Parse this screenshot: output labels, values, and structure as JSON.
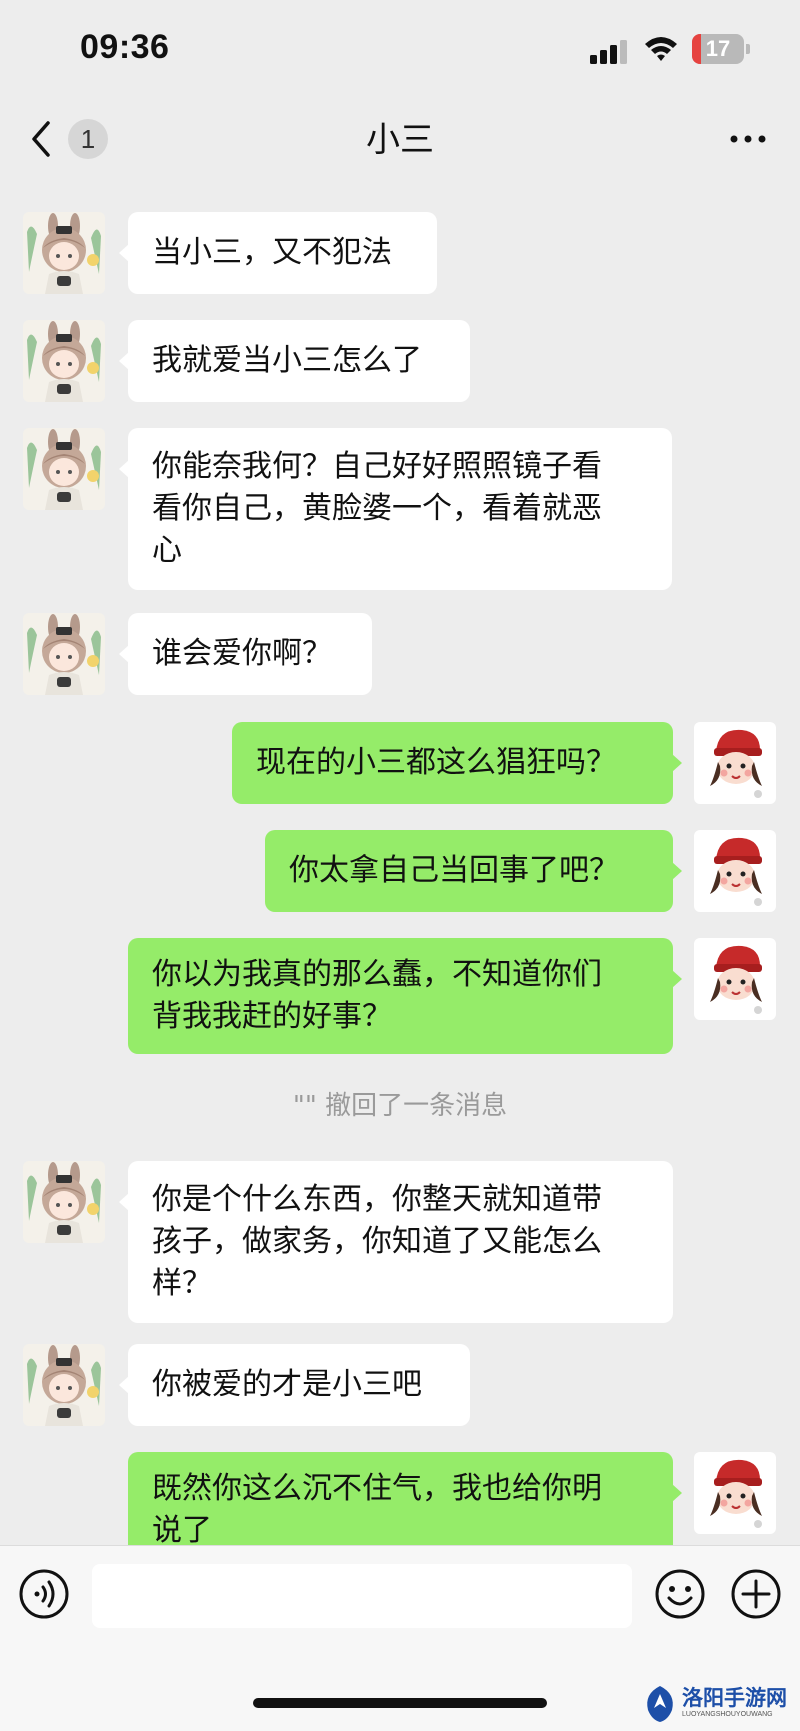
{
  "status_bar": {
    "time": "09:36",
    "battery_level": "17",
    "battery_fraction": 0.17,
    "battery_color": "#e64340",
    "icons": [
      "signal-icon",
      "wifi-icon",
      "battery-icon"
    ]
  },
  "nav": {
    "title": "小三",
    "unread_count": "1",
    "icons": [
      "back-chevron-icon",
      "more-dots-icon"
    ]
  },
  "colors": {
    "background": "#ededed",
    "incoming_bubble": "#ffffff",
    "outgoing_bubble": "#95ec69",
    "recall_text": "#9a9a9a"
  },
  "messages": [
    {
      "side": "in",
      "text": "当小三，又不犯法"
    },
    {
      "side": "in",
      "text": "我就爱当小三怎么了"
    },
    {
      "side": "in",
      "text": "你能奈我何？自己好好照照镜子看\n看你自己，黄脸婆一个，看着就恶\n心"
    },
    {
      "side": "in",
      "text": "谁会爱你啊？"
    },
    {
      "side": "out",
      "text": "现在的小三都这么猖狂吗？"
    },
    {
      "side": "out",
      "text": "你太拿自己当回事了吧？"
    },
    {
      "side": "out",
      "text": "你以为我真的那么蠢，不知道你们\n背我我赶的好事？"
    },
    {
      "side": "in",
      "text": "你是个什么东西，你整天就知道带\n孩子，做家务，你知道了又能怎么\n样？"
    },
    {
      "side": "in",
      "text": "你被爱的才是小三吧"
    },
    {
      "side": "out",
      "text": "既然你这么沉不住气，我也给你明\n说了"
    }
  ],
  "recall_notice": "\"\" 撤回了一条消息",
  "input_bar": {
    "placeholder": "",
    "icons": [
      "voice-icon",
      "emoji-icon",
      "plus-icon"
    ]
  },
  "watermark": {
    "text": "洛阳手游网",
    "subtext": "LUOYANGSHOUYOUWANG"
  }
}
